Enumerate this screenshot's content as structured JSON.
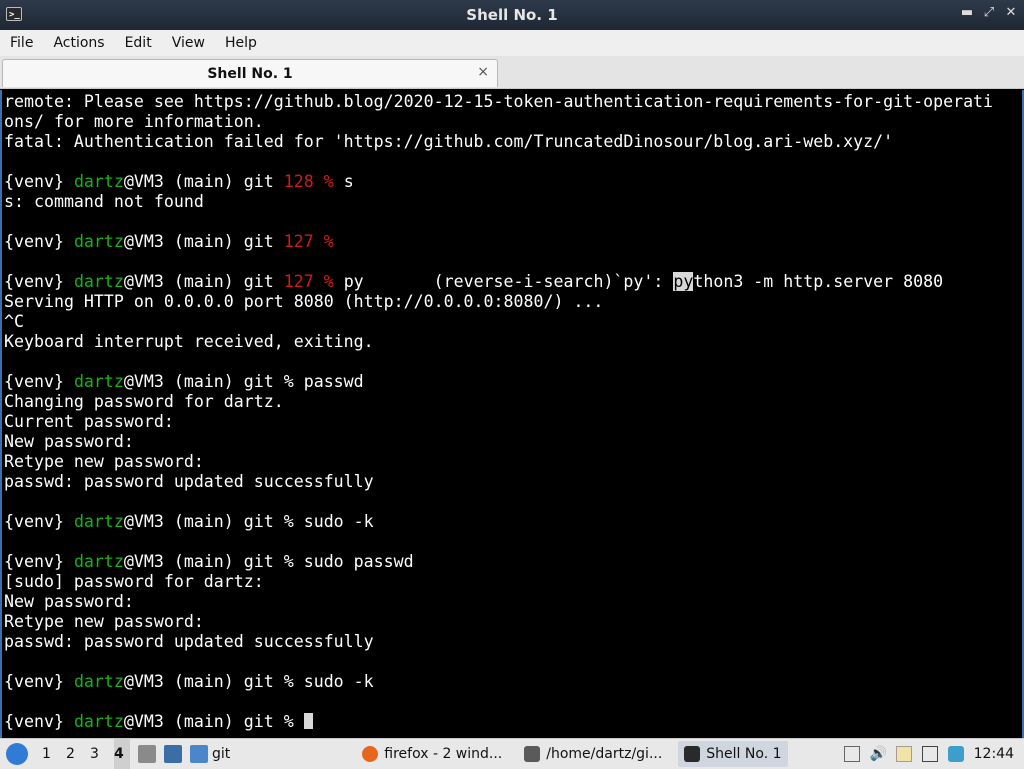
{
  "window": {
    "title": "Shell No. 1"
  },
  "menu": [
    "File",
    "Actions",
    "Edit",
    "View",
    "Help"
  ],
  "tab": {
    "label": "Shell No. 1",
    "close_label": "×"
  },
  "terminal": {
    "lines": [
      {
        "segments": [
          {
            "t": "remote: Please see https://github.blog/2020-12-15-token-authentication-requirements-for-git-operati"
          }
        ]
      },
      {
        "segments": [
          {
            "t": "ons/ for more information."
          }
        ]
      },
      {
        "segments": [
          {
            "t": "fatal: Authentication failed for 'https://github.com/TruncatedDinosour/blog.ari-web.xyz/'"
          }
        ]
      },
      {
        "segments": []
      },
      {
        "segments": [
          {
            "t": "{venv} "
          },
          {
            "t": "dartz",
            "c": "g"
          },
          {
            "t": "@VM3 (main) git "
          },
          {
            "t": "128 %",
            "c": "r"
          },
          {
            "t": " s"
          }
        ]
      },
      {
        "segments": [
          {
            "t": "s: command not found"
          }
        ]
      },
      {
        "segments": []
      },
      {
        "segments": [
          {
            "t": "{venv} "
          },
          {
            "t": "dartz",
            "c": "g"
          },
          {
            "t": "@VM3 (main) git "
          },
          {
            "t": "127 %",
            "c": "r"
          }
        ]
      },
      {
        "segments": []
      },
      {
        "segments": [
          {
            "t": "{venv} "
          },
          {
            "t": "dartz",
            "c": "g"
          },
          {
            "t": "@VM3 (main) git "
          },
          {
            "t": "127 %",
            "c": "r"
          },
          {
            "t": " py       (reverse-i-search)`py': "
          },
          {
            "t": "py",
            "c": "hl"
          },
          {
            "t": "thon3 -m http.server 8080"
          }
        ]
      },
      {
        "segments": [
          {
            "t": "Serving HTTP on 0.0.0.0 port 8080 (http://0.0.0.0:8080/) ..."
          }
        ]
      },
      {
        "segments": [
          {
            "t": "^C"
          }
        ]
      },
      {
        "segments": [
          {
            "t": "Keyboard interrupt received, exiting."
          }
        ]
      },
      {
        "segments": []
      },
      {
        "segments": [
          {
            "t": "{venv} "
          },
          {
            "t": "dartz",
            "c": "g"
          },
          {
            "t": "@VM3 (main) git % passwd"
          }
        ]
      },
      {
        "segments": [
          {
            "t": "Changing password for dartz."
          }
        ]
      },
      {
        "segments": [
          {
            "t": "Current password:"
          }
        ]
      },
      {
        "segments": [
          {
            "t": "New password:"
          }
        ]
      },
      {
        "segments": [
          {
            "t": "Retype new password:"
          }
        ]
      },
      {
        "segments": [
          {
            "t": "passwd: password updated successfully"
          }
        ]
      },
      {
        "segments": []
      },
      {
        "segments": [
          {
            "t": "{venv} "
          },
          {
            "t": "dartz",
            "c": "g"
          },
          {
            "t": "@VM3 (main) git % sudo -k"
          }
        ]
      },
      {
        "segments": []
      },
      {
        "segments": [
          {
            "t": "{venv} "
          },
          {
            "t": "dartz",
            "c": "g"
          },
          {
            "t": "@VM3 (main) git % sudo passwd"
          }
        ]
      },
      {
        "segments": [
          {
            "t": "[sudo] password for dartz:"
          }
        ]
      },
      {
        "segments": [
          {
            "t": "New password:"
          }
        ]
      },
      {
        "segments": [
          {
            "t": "Retype new password:"
          }
        ]
      },
      {
        "segments": [
          {
            "t": "passwd: password updated successfully"
          }
        ]
      },
      {
        "segments": []
      },
      {
        "segments": [
          {
            "t": "{venv} "
          },
          {
            "t": "dartz",
            "c": "g"
          },
          {
            "t": "@VM3 (main) git % sudo -k"
          }
        ]
      },
      {
        "segments": []
      },
      {
        "segments": [
          {
            "t": "{venv} "
          },
          {
            "t": "dartz",
            "c": "g"
          },
          {
            "t": "@VM3 (main) git % "
          },
          {
            "cursor": true
          }
        ]
      }
    ]
  },
  "taskbar": {
    "workspaces": [
      "1",
      "2",
      "3",
      "4"
    ],
    "active_workspace": "4",
    "folder_label": "git",
    "tasks": [
      {
        "label": "firefox - 2 wind...",
        "icon": "firefox-icon",
        "color": "#e8661c"
      },
      {
        "label": "/home/dartz/gi...",
        "icon": "text-editor-icon",
        "color": "#5a5a5a"
      },
      {
        "label": "Shell No. 1",
        "icon": "terminal-icon",
        "color": "#2a2a2a"
      }
    ],
    "clock": "12:44"
  }
}
